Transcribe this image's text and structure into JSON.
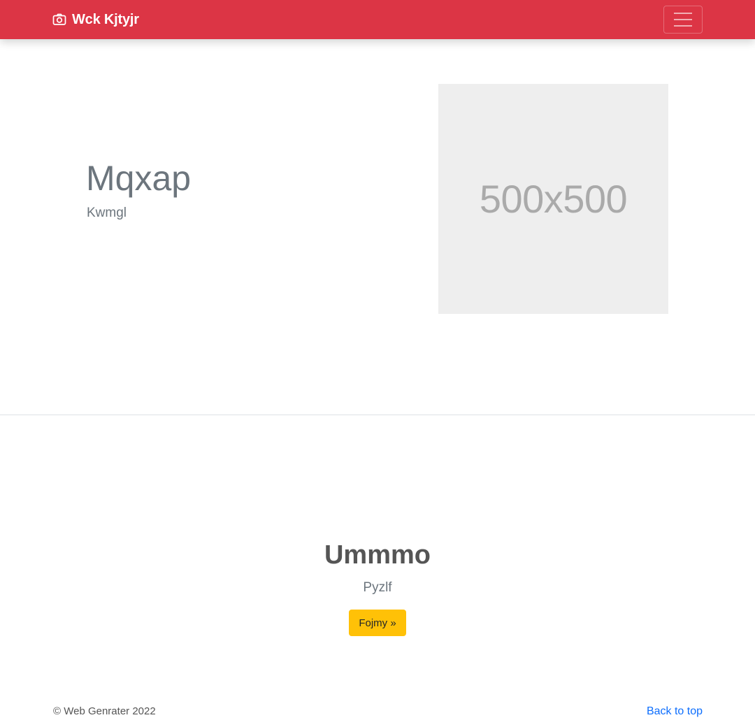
{
  "navbar": {
    "brand_icon": "camera-icon",
    "brand_text": "Wck Kjtyjr",
    "toggler_icon": "hamburger-menu-icon",
    "background_color": "#dc3545"
  },
  "hero": {
    "heading": "Mqxap",
    "lead": "Kwmgl",
    "image_placeholder_text": "500x500",
    "image_placeholder_background": "#eeeeee"
  },
  "cta": {
    "heading": "Ummmo",
    "lead": "Pyzlf",
    "button_label": "Fojmy »",
    "button_color": "#ffc107"
  },
  "footer": {
    "copyright": "© Web Genrater 2022",
    "back_to_top": "Back to top",
    "link_color": "#0d6efd"
  }
}
